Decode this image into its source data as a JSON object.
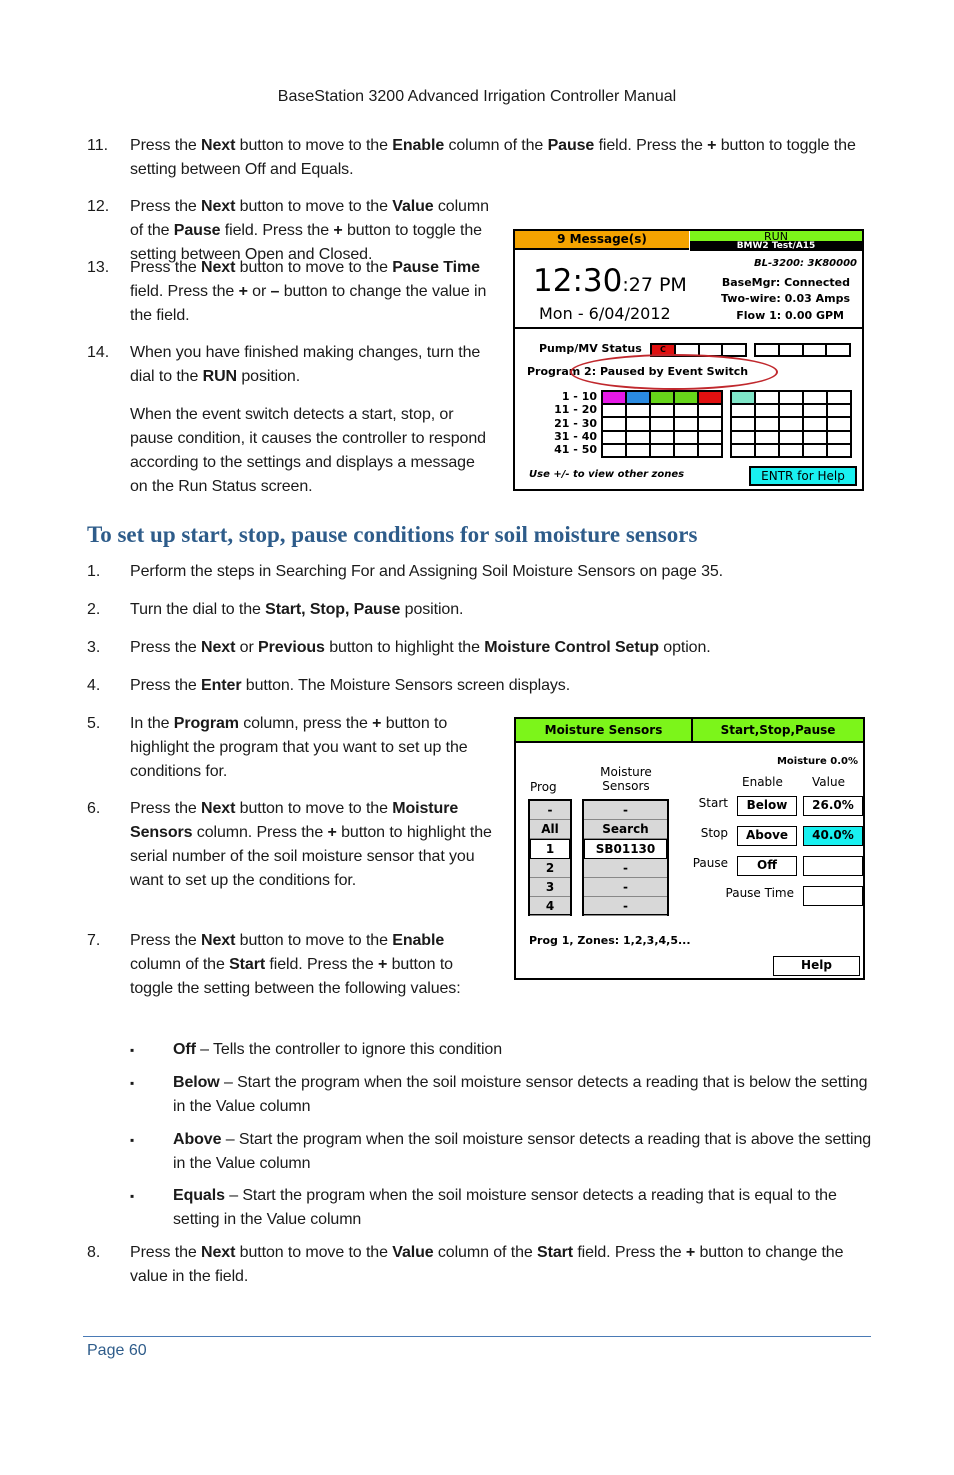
{
  "header": "BaseStation 3200 Advanced Irrigation Controller Manual",
  "items_top": [
    {
      "num": "11.",
      "segs": [
        [
          "Press the "
        ],
        [
          "Next",
          1
        ],
        [
          " button to move to the "
        ],
        [
          "Enable",
          1
        ],
        [
          " column of the "
        ],
        [
          "Pause",
          1
        ],
        [
          " field. Press the "
        ],
        [
          "+",
          1
        ],
        [
          " button to toggle the setting between Off and Equals."
        ]
      ]
    },
    {
      "num": "12.",
      "segs": [
        [
          "Press the "
        ],
        [
          "Next",
          1
        ],
        [
          " button to move to the "
        ],
        [
          "Value",
          1
        ],
        [
          " column of the "
        ],
        [
          "Pause",
          1
        ],
        [
          " field. Press the "
        ],
        [
          "+",
          1
        ],
        [
          " button to toggle the setting between Open and Closed."
        ]
      ]
    },
    {
      "num": "13.",
      "segs": [
        [
          "Press the "
        ],
        [
          "Next",
          1
        ],
        [
          " button to move to the "
        ],
        [
          "Pause Time",
          1
        ],
        [
          " field. Press the "
        ],
        [
          "+",
          1
        ],
        [
          " or "
        ],
        [
          "–",
          1
        ],
        [
          " button to change the value in the field."
        ]
      ]
    },
    {
      "num": "14.",
      "segs": [
        [
          "When you have finished making changes, turn the dial to the "
        ],
        [
          "RUN",
          1
        ],
        [
          " position."
        ]
      ]
    },
    {
      "num": "",
      "segs": [
        [
          "When the event switch detects a start, stop, or pause condition, it causes the controller to respond according to the settings and displays a message on the Run Status screen."
        ]
      ]
    }
  ],
  "section_title": "To set up start, stop, pause conditions for soil moisture sensors",
  "items_bottom": [
    {
      "num": "1.",
      "segs": [
        [
          "Perform the steps in Searching For and Assigning Soil Moisture Sensors on page 35."
        ]
      ]
    },
    {
      "num": "2.",
      "segs": [
        [
          "Turn the dial to the "
        ],
        [
          "Start, Stop, Pause",
          1
        ],
        [
          " position."
        ]
      ]
    },
    {
      "num": "3.",
      "segs": [
        [
          "Press the "
        ],
        [
          "Next",
          1
        ],
        [
          " or "
        ],
        [
          "Previous",
          1
        ],
        [
          " button to highlight the "
        ],
        [
          "Moisture Control Setup",
          1
        ],
        [
          " option."
        ]
      ]
    },
    {
      "num": "4.",
      "segs": [
        [
          "Press the "
        ],
        [
          "Enter",
          1
        ],
        [
          " button. The Moisture Sensors screen displays."
        ]
      ]
    },
    {
      "num": "5.",
      "segs": [
        [
          "In the "
        ],
        [
          "Program",
          1
        ],
        [
          " column, press the "
        ],
        [
          "+",
          1
        ],
        [
          " button to highlight the program that you want to set up the conditions for."
        ]
      ]
    },
    {
      "num": "6.",
      "segs": [
        [
          "Press the "
        ],
        [
          "Next",
          1
        ],
        [
          " button to move to the "
        ],
        [
          "Moisture Sensors",
          1
        ],
        [
          " column. Press the "
        ],
        [
          "+",
          1
        ],
        [
          " button to highlight the serial number of the soil moisture sensor that you want to set up the conditions for."
        ]
      ]
    },
    {
      "num": "7.",
      "segs": [
        [
          "Press the "
        ],
        [
          "Next",
          1
        ],
        [
          " button to move to the "
        ],
        [
          "Enable",
          1
        ],
        [
          " column of the "
        ],
        [
          "Start",
          1
        ],
        [
          " field. Press the "
        ],
        [
          "+",
          1
        ],
        [
          " button to toggle the setting between the following values:"
        ]
      ]
    },
    {
      "num": "▪",
      "segs": [
        [
          "Off",
          1
        ],
        [
          " – Tells the controller to ignore this condition"
        ]
      ]
    },
    {
      "num": "▪",
      "segs": [
        [
          "Below",
          1
        ],
        [
          " – Start the program when the soil moisture sensor detects a reading that is below the setting in the Value column"
        ]
      ]
    },
    {
      "num": "▪",
      "segs": [
        [
          "Above",
          1
        ],
        [
          " – Start the program when the soil moisture sensor detects a reading that is above the setting in the Value column"
        ]
      ]
    },
    {
      "num": "▪",
      "segs": [
        [
          "Equals",
          1
        ],
        [
          " – Start the program when the soil moisture sensor detects a reading that is equal to the setting in the Value column"
        ]
      ]
    },
    {
      "num": "8.",
      "segs": [
        [
          "Press the "
        ],
        [
          "Next",
          1
        ],
        [
          " button to move to the "
        ],
        [
          "Value",
          1
        ],
        [
          " column of the "
        ],
        [
          "Start",
          1
        ],
        [
          " field. Press the "
        ],
        [
          "+",
          1
        ],
        [
          " button to change the value in the field."
        ]
      ]
    }
  ],
  "screen1": {
    "messages": "9 Message(s)",
    "mode": "RUN",
    "controller_name": "BMW2 Test/A15",
    "serial": "BL-3200: 3K80000",
    "time_hm": "12:30",
    "time_sec": ":27 PM",
    "date": "Mon - 6/04/2012",
    "basemgr": "BaseMgr: Connected",
    "twowire": "Two-wire:  0.03 Amps",
    "flow": "Flow 1: 0.00 GPM",
    "pump_label": "Pump/MV Status",
    "pump_first": "C",
    "program_status": "Program 2: Paused by Event Switch",
    "row_labels": [
      "1 - 10",
      "11 - 20",
      "21 - 30",
      "31 - 40",
      "41 - 50"
    ],
    "zone_colors": [
      "#e619e6",
      "#2a8ae0",
      "#66d61a",
      "#66d61a",
      "#e01010",
      "#7fe6c8"
    ],
    "hint": "Use +/- to view other zones",
    "help": "ENTR for Help",
    "colors": {
      "messages": "#f5a300",
      "run": "#7cf51a",
      "help": "#19f0f0",
      "pump_active": "#e01010",
      "highlight_ellipse": "#c0282d"
    }
  },
  "screen2": {
    "tab1": "Moisture Sensors",
    "tab2": "Start,Stop,Pause",
    "moisture": "Moisture 0.0%",
    "prog_header": "Prog",
    "sensors_header_1": "Moisture",
    "sensors_header_2": "Sensors",
    "prog_list": [
      "-",
      "All",
      "1",
      "2",
      "3",
      "4"
    ],
    "sensor_list": [
      "-",
      "Search",
      "SB01130",
      "-",
      "-",
      "-"
    ],
    "selected_index": 2,
    "enable_header": "Enable",
    "value_header": "Value",
    "start_label": "Start",
    "start_enable": "Below",
    "start_value": "26.0%",
    "stop_label": "Stop",
    "stop_enable": "Above",
    "stop_value": "40.0%",
    "pause_label": "Pause",
    "pause_enable": "Off",
    "pause_value": "",
    "pause_time_label": "Pause Time",
    "pause_time_value": "",
    "footer": "Prog 1, Zones: 1,2,3,4,5...",
    "help": "Help",
    "colors": {
      "tabs": "#7cf51a",
      "selected_value": "#19f0f0"
    }
  },
  "footer": {
    "page": "Page 60"
  }
}
